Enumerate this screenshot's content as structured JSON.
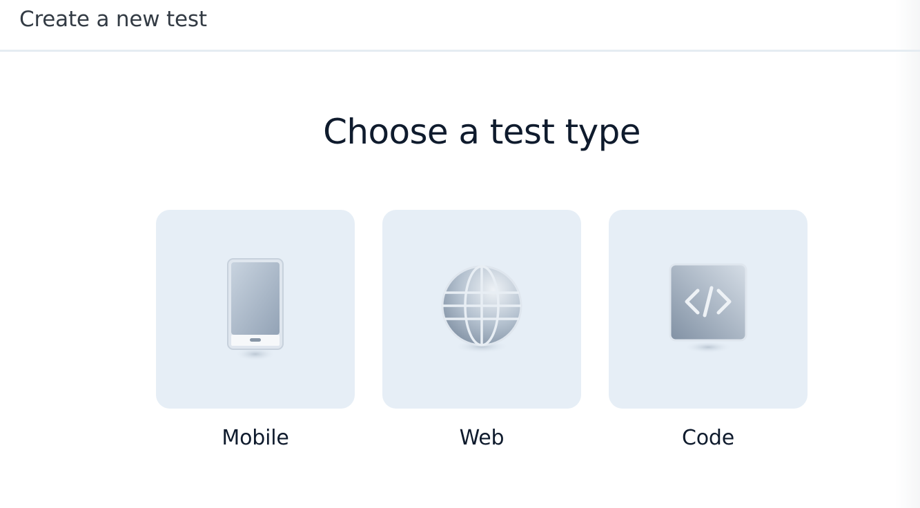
{
  "header": {
    "title": "Create a new test"
  },
  "main": {
    "heading": "Choose a test type",
    "options": [
      {
        "label": "Mobile",
        "icon": "mobile-phone-icon"
      },
      {
        "label": "Web",
        "icon": "globe-icon"
      },
      {
        "label": "Code",
        "icon": "code-icon"
      }
    ]
  },
  "colors": {
    "tile_background": "#e6eef6",
    "text_primary": "#0f1b2d",
    "header_text": "#333b44",
    "divider": "#e5ecf2"
  }
}
